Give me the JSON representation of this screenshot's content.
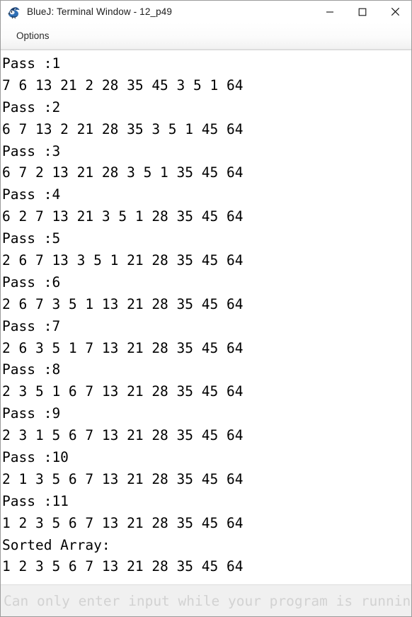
{
  "window": {
    "title": "BlueJ: Terminal Window - 12_p49",
    "icon": "bluej-bird-icon",
    "controls": [
      {
        "name": "minimize-button",
        "glyph": "minimize-icon",
        "label": "—"
      },
      {
        "name": "maximize-button",
        "glyph": "maximize-icon",
        "label": "□"
      },
      {
        "name": "close-button",
        "glyph": "close-icon",
        "label": "✕"
      }
    ]
  },
  "menubar": {
    "items": [
      {
        "label": "Options"
      }
    ]
  },
  "terminal": {
    "lines": [
      "Pass :1",
      "7 6 13 21 2 28 35 45 3 5 1 64",
      "Pass :2",
      "6 7 13 2 21 28 35 3 5 1 45 64",
      "Pass :3",
      "6 7 2 13 21 28 3 5 1 35 45 64",
      "Pass :4",
      "6 2 7 13 21 3 5 1 28 35 45 64",
      "Pass :5",
      "2 6 7 13 3 5 1 21 28 35 45 64",
      "Pass :6",
      "2 6 7 3 5 1 13 21 28 35 45 64",
      "Pass :7",
      "2 6 3 5 1 7 13 21 28 35 45 64",
      "Pass :8",
      "2 3 5 1 6 7 13 21 28 35 45 64",
      "Pass :9",
      "2 3 1 5 6 7 13 21 28 35 45 64",
      "Pass :10",
      "2 1 3 5 6 7 13 21 28 35 45 64",
      "Pass :11",
      "1 2 3 5 6 7 13 21 28 35 45 64",
      "Sorted Array:",
      "1 2 3 5 6 7 13 21 28 35 45 64"
    ]
  },
  "input": {
    "value": "",
    "placeholder": "Can only enter input while your program is running"
  },
  "colors": {
    "window_bg": "#ffffff",
    "titlebar_bg": "#ffffff",
    "title_text": "#1c1c1c",
    "menubar_bg": "#f4f4f4",
    "terminal_text": "#000000",
    "input_bar_bg": "#f0f0f0",
    "input_placeholder_text": "#d2d2d2",
    "border": "#9b9b9b"
  }
}
